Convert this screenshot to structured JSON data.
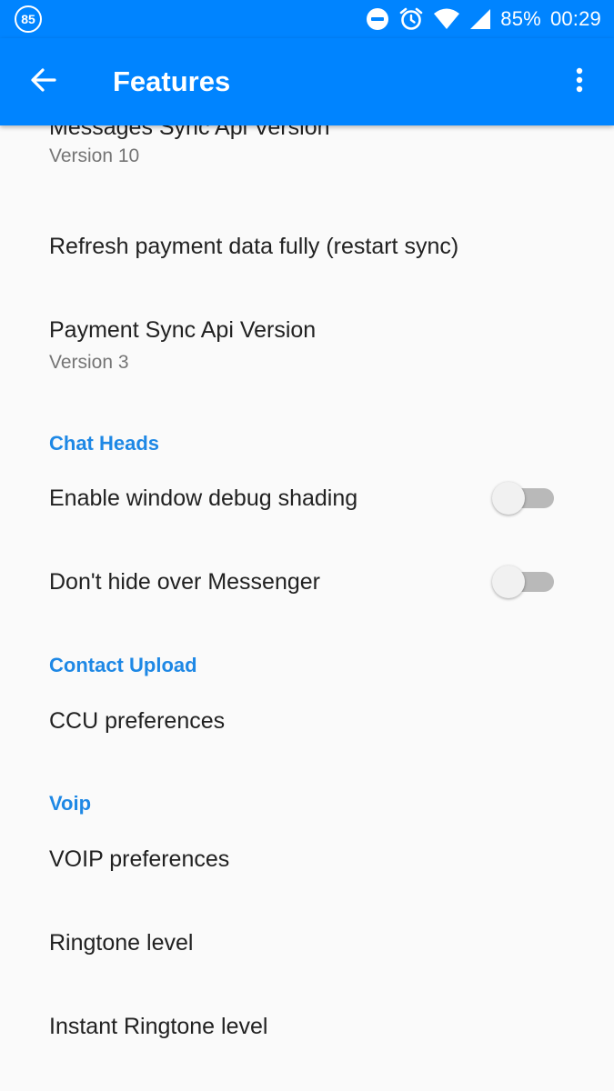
{
  "status_bar": {
    "notification_count": "85",
    "battery": "85%",
    "time": "00:29",
    "icons": [
      "do-not-disturb-icon",
      "alarm-icon",
      "wifi-icon",
      "signal-icon"
    ]
  },
  "app_bar": {
    "title": "Features",
    "back_icon": "arrow-left-icon",
    "menu_icon": "more-vert-icon",
    "color": "#0084ff"
  },
  "prefs": {
    "messages_sync": {
      "title": "Messages Sync Api Version",
      "summary": "Version 10"
    },
    "refresh_payment": {
      "title": "Refresh payment data fully (restart sync)"
    },
    "payment_sync": {
      "title": "Payment Sync Api Version",
      "summary": "Version 3"
    },
    "chat_heads_header": "Chat Heads",
    "debug_shading": {
      "title": "Enable window debug shading",
      "enabled": false
    },
    "dont_hide": {
      "title": "Don't hide over Messenger",
      "enabled": false
    },
    "contact_upload_header": "Contact Upload",
    "ccu": {
      "title": "CCU preferences"
    },
    "voip_header": "Voip",
    "voip_prefs": {
      "title": "VOIP preferences"
    },
    "ringtone": {
      "title": "Ringtone level"
    },
    "instant_ringtone": {
      "title": "Instant Ringtone level"
    }
  },
  "colors": {
    "accent": "#1e88e5",
    "background": "#fafafa",
    "switch_off_track": "#b9b9b9"
  }
}
